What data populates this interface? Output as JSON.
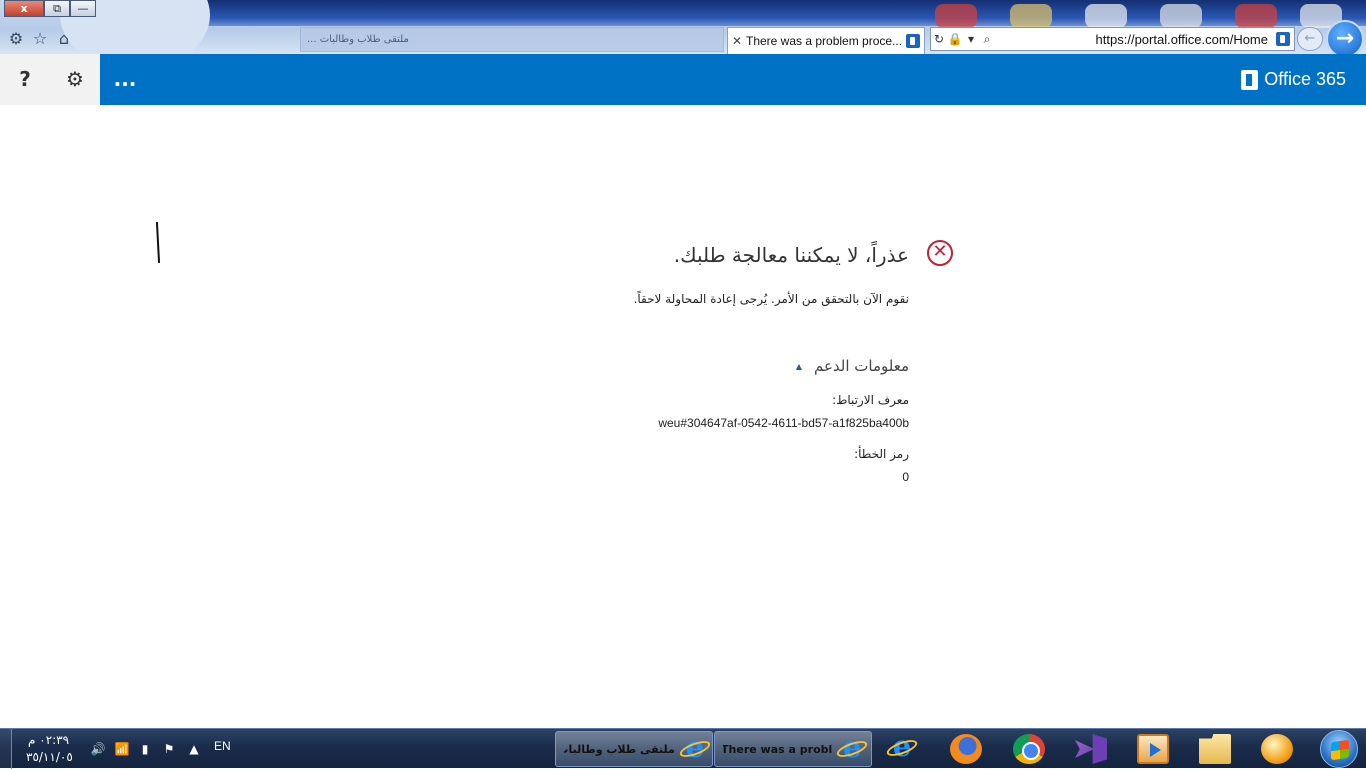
{
  "browser": {
    "window_buttons": {
      "close": "x",
      "restore": "⧉",
      "minimize": "—"
    },
    "tabs": [
      {
        "title": "There was a problem proce...",
        "active": true
      },
      {
        "title": "ملتقى طلاب وطالبات ...",
        "active": false
      }
    ],
    "address_url": "https://portal.office.com/Home",
    "icons": [
      "gear-icon",
      "star-icon",
      "home-icon",
      "refresh-icon",
      "lock-icon",
      "search-icon",
      "back-arrow-icon",
      "forward-arrow-icon"
    ]
  },
  "header": {
    "brand": "Office 365",
    "more": "...",
    "help": "?",
    "settings_icon": "gear-icon",
    "bar_color": "#0072c6"
  },
  "error": {
    "title": "عذراً، لا يمكننا معالجة طلبك.",
    "description": "نقوم الآن بالتحقق من الأمر. يُرجى إعادة المحاولة لاحقاً.",
    "support_heading": "معلومات الدعم",
    "correlation_label": "معرف الارتباط:",
    "correlation_value": "weu#304647af-0542-4611-bd57-a1f825ba400b",
    "code_label": "رمز الخطأ:",
    "code_value": "0",
    "icon": "error-circle-x-icon",
    "icon_color": "#c41e3a"
  },
  "taskbar": {
    "windows": [
      {
        "title": "There was a probl..."
      },
      {
        "title": "ملتقى طلاب وطالبات ..."
      }
    ],
    "pinned": [
      "internet-explorer-icon",
      "firefox-icon",
      "chrome-icon",
      "visual-studio-icon",
      "media-player-icon",
      "file-explorer-icon",
      "orb-app-icon"
    ],
    "language": "EN",
    "clock_time": "٠٢:٣٩ م",
    "clock_date": "٣٥/١١/٠٥"
  }
}
